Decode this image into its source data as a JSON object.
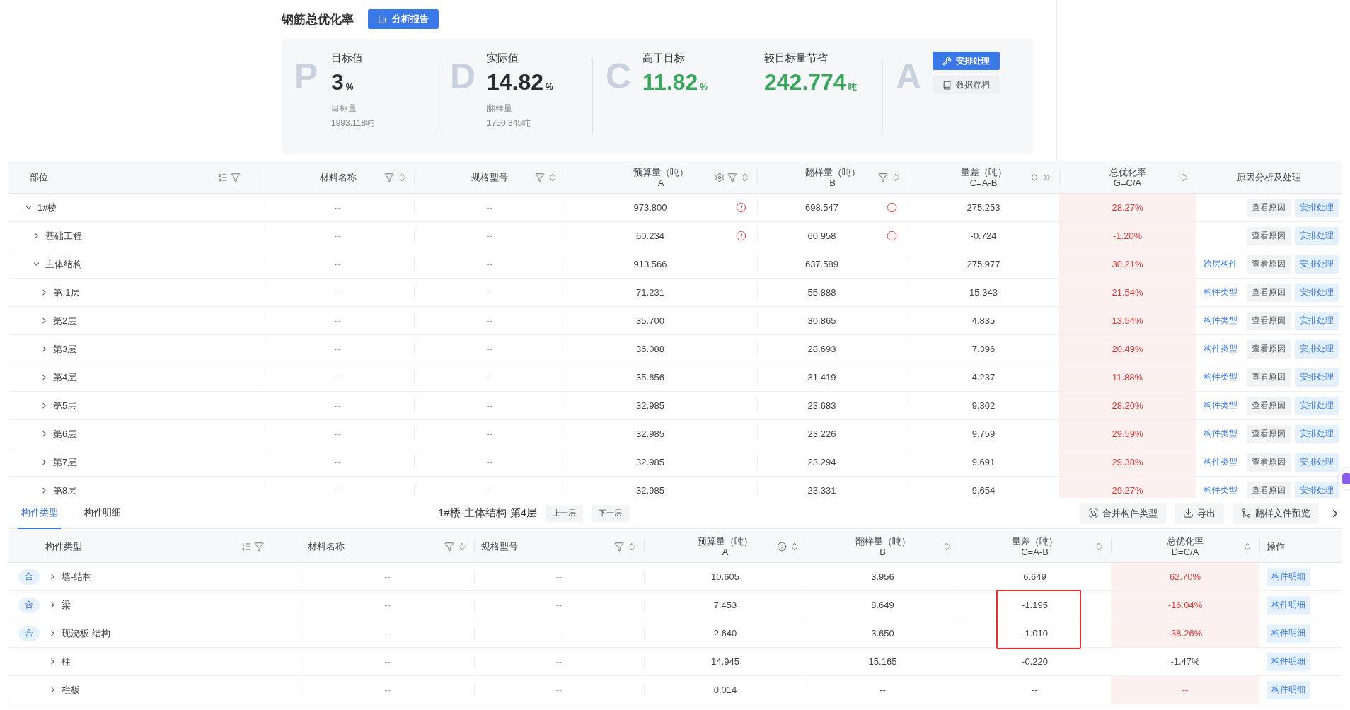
{
  "header": {
    "title": "钢筋总优化率",
    "report_button": "分析报告"
  },
  "kpi": {
    "groups": [
      {
        "letter": "P",
        "metrics": [
          {
            "label": "目标值",
            "value": "3",
            "unit": "%",
            "color": "#2b2b2b",
            "sub_label": "目标量",
            "sub_value": "1993.118吨"
          }
        ]
      },
      {
        "letter": "D",
        "metrics": [
          {
            "label": "实际值",
            "value": "14.82",
            "unit": "%",
            "color": "#2b2b2b",
            "sub_label": "翻样量",
            "sub_value": "1750.345吨"
          }
        ]
      },
      {
        "letter": "C",
        "metrics": [
          {
            "label": "高于目标",
            "value": "11.82",
            "unit": "%",
            "color": "#3aa55c"
          },
          {
            "label": "较目标量节省",
            "value": "242.774",
            "unit": "吨",
            "color": "#3aa55c"
          }
        ]
      },
      {
        "letter": "A",
        "actions": [
          {
            "label": "安排处理",
            "kind": "primary"
          },
          {
            "label": "数据存档",
            "kind": "secondary"
          }
        ]
      }
    ]
  },
  "main_table": {
    "columns": [
      {
        "label": "部位"
      },
      {
        "label": "材料名称"
      },
      {
        "label": "规格型号"
      },
      {
        "label": "预算量（吨）",
        "sub": "A"
      },
      {
        "label": "翻样量（吨）",
        "sub": "B"
      },
      {
        "label": "量差（吨）",
        "sub": "C=A-B"
      },
      {
        "label": "总优化率",
        "sub": "G=C/A"
      },
      {
        "label": "原因分析及处理"
      }
    ],
    "rows": [
      {
        "name": "1#楼",
        "expanded": true,
        "material": "--",
        "spec": "--",
        "budget": "973.800",
        "budget_warning": true,
        "layout": "698.547",
        "layout_warning": true,
        "diff": "275.253",
        "rate": "28.27%",
        "alert": true,
        "actions": [
          {
            "label": "查看原因",
            "kind": "gray"
          },
          {
            "label": "安排处理",
            "kind": "primary"
          }
        ],
        "children": [
          {
            "name": "基础工程",
            "expanded": false,
            "material": "--",
            "spec": "--",
            "budget": "60.234",
            "budget_warning": true,
            "layout": "60.958",
            "layout_warning": true,
            "diff": "-0.724",
            "rate": "-1.20%",
            "alert": true,
            "actions": [
              {
                "label": "查看原因",
                "kind": "gray"
              },
              {
                "label": "安排处理",
                "kind": "primary"
              }
            ]
          },
          {
            "name": "主体结构",
            "expanded": true,
            "material": "--",
            "spec": "--",
            "budget": "913.566",
            "budget_warning": false,
            "layout": "637.589",
            "layout_warning": false,
            "diff": "275.977",
            "rate": "30.21%",
            "alert": true,
            "actions": [
              {
                "label": "跨层构件",
                "kind": "link"
              },
              {
                "label": "查看原因",
                "kind": "gray"
              },
              {
                "label": "安排处理",
                "kind": "primary"
              }
            ],
            "children": [
              {
                "name": "第-1层",
                "expanded": false,
                "material": "--",
                "spec": "--",
                "budget": "71.231",
                "budget_warning": false,
                "layout": "55.888",
                "layout_warning": false,
                "diff": "15.343",
                "rate": "21.54%",
                "alert": true,
                "actions": [
                  {
                    "label": "构件类型",
                    "kind": "link"
                  },
                  {
                    "label": "查看原因",
                    "kind": "gray"
                  },
                  {
                    "label": "安排处理",
                    "kind": "primary"
                  }
                ]
              },
              {
                "name": "第2层",
                "expanded": false,
                "material": "--",
                "spec": "--",
                "budget": "35.700",
                "budget_warning": false,
                "layout": "30.865",
                "layout_warning": false,
                "diff": "4.835",
                "rate": "13.54%",
                "alert": true,
                "actions": [
                  {
                    "label": "构件类型",
                    "kind": "link"
                  },
                  {
                    "label": "查看原因",
                    "kind": "gray"
                  },
                  {
                    "label": "安排处理",
                    "kind": "primary"
                  }
                ]
              },
              {
                "name": "第3层",
                "expanded": false,
                "material": "--",
                "spec": "--",
                "budget": "36.088",
                "budget_warning": false,
                "layout": "28.693",
                "layout_warning": false,
                "diff": "7.396",
                "rate": "20.49%",
                "alert": true,
                "actions": [
                  {
                    "label": "构件类型",
                    "kind": "link"
                  },
                  {
                    "label": "查看原因",
                    "kind": "gray"
                  },
                  {
                    "label": "安排处理",
                    "kind": "primary"
                  }
                ]
              },
              {
                "name": "第4层",
                "expanded": false,
                "material": "--",
                "spec": "--",
                "budget": "35.656",
                "budget_warning": false,
                "layout": "31.419",
                "layout_warning": false,
                "diff": "4.237",
                "rate": "11.88%",
                "alert": true,
                "actions": [
                  {
                    "label": "构件类型",
                    "kind": "link"
                  },
                  {
                    "label": "查看原因",
                    "kind": "gray"
                  },
                  {
                    "label": "安排处理",
                    "kind": "primary"
                  }
                ]
              },
              {
                "name": "第5层",
                "expanded": false,
                "material": "--",
                "spec": "--",
                "budget": "32.985",
                "budget_warning": false,
                "layout": "23.683",
                "layout_warning": false,
                "diff": "9.302",
                "rate": "28.20%",
                "alert": true,
                "actions": [
                  {
                    "label": "构件类型",
                    "kind": "link"
                  },
                  {
                    "label": "查看原因",
                    "kind": "gray"
                  },
                  {
                    "label": "安排处理",
                    "kind": "primary"
                  }
                ]
              },
              {
                "name": "第6层",
                "expanded": false,
                "material": "--",
                "spec": "--",
                "budget": "32.985",
                "budget_warning": false,
                "layout": "23.226",
                "layout_warning": false,
                "diff": "9.759",
                "rate": "29.59%",
                "alert": true,
                "actions": [
                  {
                    "label": "构件类型",
                    "kind": "link"
                  },
                  {
                    "label": "查看原因",
                    "kind": "gray"
                  },
                  {
                    "label": "安排处理",
                    "kind": "primary"
                  }
                ]
              },
              {
                "name": "第7层",
                "expanded": false,
                "material": "--",
                "spec": "--",
                "budget": "32.985",
                "budget_warning": false,
                "layout": "23.294",
                "layout_warning": false,
                "diff": "9.691",
                "rate": "29.38%",
                "alert": true,
                "actions": [
                  {
                    "label": "构件类型",
                    "kind": "link"
                  },
                  {
                    "label": "查看原因",
                    "kind": "gray"
                  },
                  {
                    "label": "安排处理",
                    "kind": "primary"
                  }
                ]
              },
              {
                "name": "第8层",
                "expanded": false,
                "material": "--",
                "spec": "--",
                "budget": "32.985",
                "budget_warning": false,
                "layout": "23.331",
                "layout_warning": false,
                "diff": "9.654",
                "rate": "29.27%",
                "alert": true,
                "actions": [
                  {
                    "label": "构件类型",
                    "kind": "link"
                  },
                  {
                    "label": "查看原因",
                    "kind": "gray"
                  },
                  {
                    "label": "安排处理",
                    "kind": "primary"
                  }
                ]
              }
            ]
          }
        ]
      }
    ]
  },
  "detail": {
    "tabs": [
      {
        "label": "构件类型",
        "selected": true
      },
      {
        "label": "构件明细",
        "selected": false
      }
    ],
    "path": "1#楼-主体结构-第4层",
    "nav": [
      "上一层",
      "下一层"
    ],
    "tools": [
      {
        "label": "合并构件类型",
        "kind": "merge"
      },
      {
        "label": "导出",
        "kind": "export"
      },
      {
        "label": "翻样文件预览",
        "kind": "preview"
      }
    ],
    "columns": [
      {
        "label": "构件类型"
      },
      {
        "label": "材料名称"
      },
      {
        "label": "规格型号"
      },
      {
        "label": "预算量（吨）",
        "sub": "A"
      },
      {
        "label": "翻样量（吨）",
        "sub": "B"
      },
      {
        "label": "量差（吨）",
        "sub": "C=A-B"
      },
      {
        "label": "总优化率",
        "sub": "D=C/A"
      },
      {
        "label": "操作"
      }
    ],
    "rows": [
      {
        "badge": "合",
        "name": "墙-结构",
        "expanded": false,
        "material": "--",
        "spec": "--",
        "budget": "10.605",
        "layout": "3.956",
        "diff": "6.649",
        "rate": "62.70%",
        "alert": true,
        "annotated": false,
        "action": "构件明细"
      },
      {
        "badge": "合",
        "name": "梁",
        "expanded": false,
        "material": "--",
        "spec": "--",
        "budget": "7.453",
        "layout": "8.649",
        "diff": "-1.195",
        "rate": "-16.04%",
        "alert": true,
        "annotated": true,
        "action": "构件明细"
      },
      {
        "badge": "合",
        "name": "现浇板-结构",
        "expanded": false,
        "material": "--",
        "spec": "--",
        "budget": "2.640",
        "layout": "3.650",
        "diff": "-1.010",
        "rate": "-38.26%",
        "alert": true,
        "annotated": true,
        "action": "构件明细"
      },
      {
        "name": "柱",
        "expanded": false,
        "material": "--",
        "spec": "--",
        "budget": "14.945",
        "layout": "15.165",
        "diff": "-0.220",
        "rate": "-1.47%",
        "alert": false,
        "annotated": false,
        "action": "构件明细"
      },
      {
        "name": "栏板",
        "expanded": false,
        "material": "--",
        "spec": "--",
        "budget": "0.014",
        "layout": "--",
        "diff": "--",
        "rate": "--",
        "alert": true,
        "annotated": false,
        "action": "构件明细"
      }
    ]
  }
}
